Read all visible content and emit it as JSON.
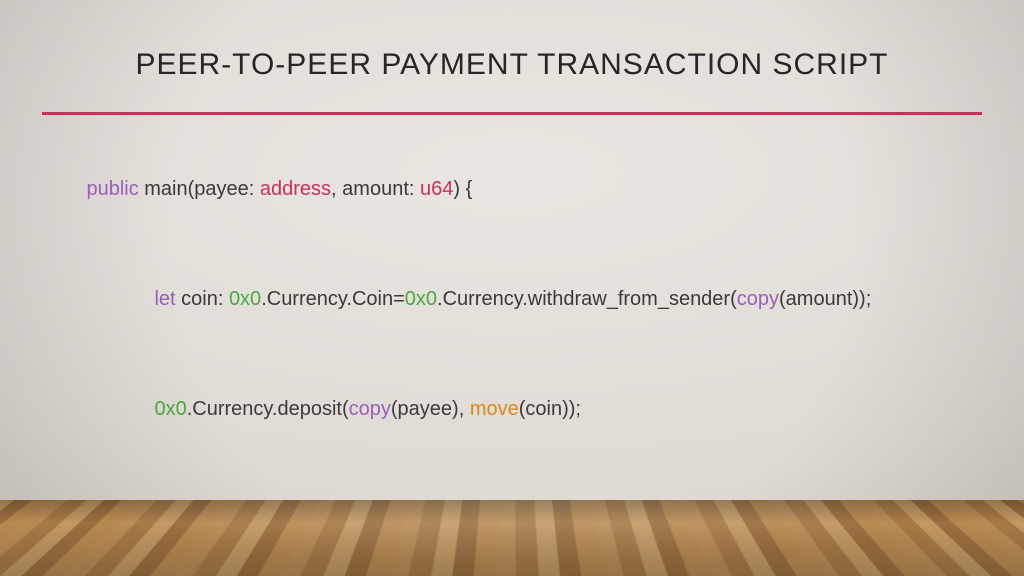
{
  "title": "PEER-TO-PEER PAYMENT TRANSACTION SCRIPT",
  "rule_color": "#c9305c",
  "colors": {
    "kw": "#9a5fbd",
    "type1": "#c9305c",
    "type2": "#c9305c",
    "hex": "#49a942",
    "copy": "#9a5fbd",
    "move": "#d68a1f",
    "text": "#3a3a3a"
  },
  "code": {
    "l1": {
      "kw": "public",
      "sp1": " main(payee: ",
      "type1": "address",
      "sp2": ", amount: ",
      "type2": "u64",
      "sp3": ") {"
    },
    "l2": {
      "kw": "let",
      "sp1": " coin: ",
      "hex1": "0x0",
      "sp2": ".Currency.Coin=",
      "hex2": "0x0",
      "sp3": ".Currency.withdraw_from_sender(",
      "copy": "copy",
      "sp4": "(amount));"
    },
    "l3": {
      "hex": "0x0",
      "sp1": ".Currency.deposit(",
      "copy": "copy",
      "sp2": "(payee), ",
      "move": "move",
      "sp3": "(coin));"
    },
    "l4": {
      "text": "}"
    }
  }
}
